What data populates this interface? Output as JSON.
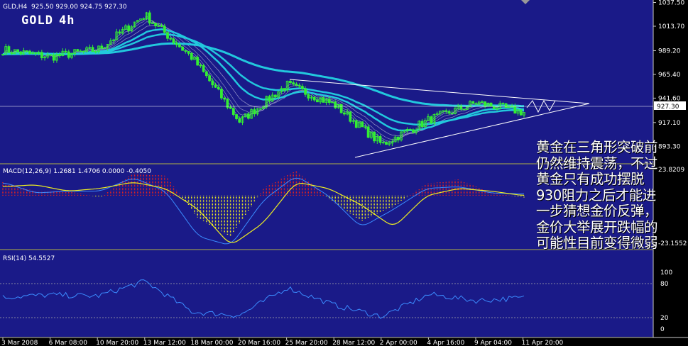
{
  "header": {
    "symbol_tf": "GLD,H4",
    "ohlc": "925.50 929.00 924.75 927.30",
    "chart_title": "GOLD",
    "chart_tf": "4h",
    "current_price": "927.30"
  },
  "price_axis": [
    "1037.50",
    "1013.70",
    "989.20",
    "965.40",
    "941.60",
    "917.10",
    "893.30"
  ],
  "macd_header": "MACD(12,26,9) 1.2681 1.4706 0.0000 -0.4050",
  "macd_axis": [
    "23.8209",
    "-23.1552"
  ],
  "rsi_header": "RSI(14) 54.5527",
  "rsi_axis": [
    "100",
    "80",
    "20",
    "0"
  ],
  "time_axis": [
    "3 Mar 2008",
    "6 Mar 08:00",
    "10 Mar 20:00",
    "13 Mar 12:00",
    "18 Mar 00:00",
    "20 Mar 16:00",
    "25 Mar 20:00",
    "28 Mar 12:00",
    "2 Apr 00:00",
    "4 Apr 16:00",
    "9 Apr 04:00",
    "11 Apr 20:00"
  ],
  "annotation": [
    "黄金在三角形突破前",
    "仍然维持震荡，不过",
    "黄金只有成功摆脱",
    "930阻力之后才能进",
    "一步猜想金价反弹，",
    "金价大举展开跌幅的",
    "可能性目前变得微弱"
  ],
  "colors": {
    "background": "#1a1a88",
    "candle": "#33ee33",
    "ma": "#22c8dd",
    "macd_pos": "#dd2222",
    "macd_neg": "#eeee22",
    "signal": "#eeee22",
    "rsi": "#3b8cff",
    "axis_text": "#ffffff"
  },
  "chart_data": [
    {
      "type": "line",
      "title": "RSI(14) 54.5527",
      "x": [
        "3 Mar 2008",
        "6 Mar 08:00",
        "10 Mar 20:00",
        "13 Mar 12:00",
        "18 Mar 00:00",
        "20 Mar 16:00",
        "25 Mar 20:00",
        "28 Mar 12:00",
        "2 Apr 00:00",
        "4 Apr 16:00",
        "9 Apr 04:00",
        "11 Apr 20:00"
      ],
      "series": [
        {
          "values": [
            56,
            60,
            58,
            84,
            30,
            24,
            73,
            42,
            22,
            61,
            50,
            55
          ]
        }
      ],
      "ylim": [
        0,
        100
      ],
      "y_ticks": [
        0,
        20,
        80,
        100
      ]
    },
    {
      "type": "line",
      "title": "GOLD 4h",
      "x": [
        "3 Mar 2008",
        "6 Mar 08:00",
        "10 Mar 20:00",
        "13 Mar 12:00",
        "18 Mar 00:00",
        "20 Mar 16:00",
        "25 Mar 20:00",
        "28 Mar 12:00",
        "2 Apr 00:00",
        "4 Apr 16:00",
        "9 Apr 04:00",
        "11 Apr 20:00"
      ],
      "series": [
        {
          "values": [
            990,
            983,
            990,
            1025,
            982,
            918,
            955,
            935,
            895,
            920,
            937,
            927.3
          ]
        }
      ],
      "ylim": [
        880,
        1040
      ],
      "y_ticks": [
        893.3,
        917.1,
        941.6,
        965.4,
        989.2,
        1013.7,
        1037.5
      ]
    }
  ]
}
